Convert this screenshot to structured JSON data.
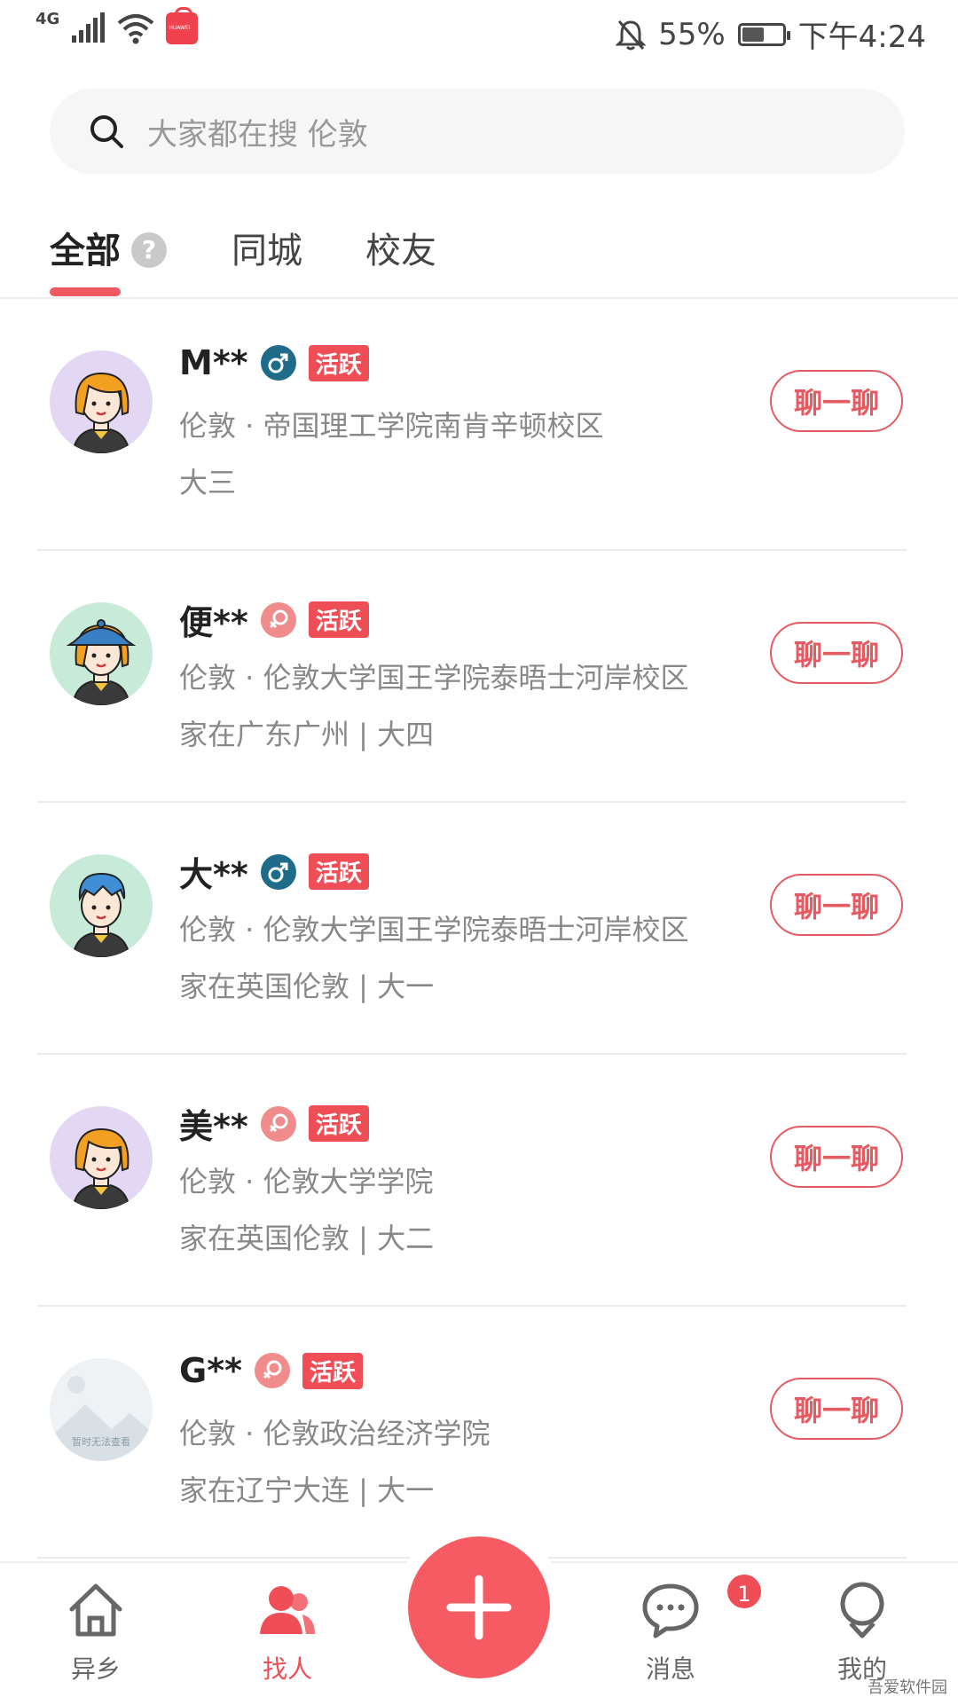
{
  "status_bar": {
    "network": "4G",
    "app_badge": "HUAWEI",
    "battery_percent": "55%",
    "battery_level": 0.55,
    "time": "下午4:24"
  },
  "search": {
    "placeholder": "大家都在搜 伦敦"
  },
  "tabs": [
    {
      "label": "全部",
      "active": true
    },
    {
      "label": "同城",
      "active": false
    },
    {
      "label": "校友",
      "active": false
    }
  ],
  "help_symbol": "?",
  "users": [
    {
      "name": "M**",
      "gender": "male",
      "badge": "活跃",
      "school": "伦敦 · 帝国理工学院南肯辛顿校区",
      "info": "大三",
      "button": "聊一聊",
      "avatar": "girl-orange-hair"
    },
    {
      "name": "便**",
      "gender": "female",
      "badge": "活跃",
      "school": "伦敦 · 伦敦大学国王学院泰晤士河岸校区",
      "info": "家在广东广州 | 大四",
      "button": "聊一聊",
      "avatar": "girl-blue-cap"
    },
    {
      "name": "大**",
      "gender": "male",
      "badge": "活跃",
      "school": "伦敦 · 伦敦大学国王学院泰晤士河岸校区",
      "info": "家在英国伦敦 | 大一",
      "button": "聊一聊",
      "avatar": "boy-blue-hair"
    },
    {
      "name": "美**",
      "gender": "female",
      "badge": "活跃",
      "school": "伦敦 · 伦敦大学学院",
      "info": "家在英国伦敦 | 大二",
      "button": "聊一聊",
      "avatar": "girl-orange-hair"
    },
    {
      "name": "G**",
      "gender": "female",
      "badge": "活跃",
      "school": "伦敦 · 伦敦政治经济学院",
      "info": "家在辽宁大连 | 大一",
      "button": "聊一聊",
      "avatar": "placeholder",
      "avatar_text": "暂时无法查看"
    }
  ],
  "nav": {
    "home": "异乡",
    "find": "找人",
    "messages": "消息",
    "messages_badge": "1",
    "me": "我的"
  },
  "watermark": "吾爱软件园",
  "colors": {
    "accent": "#ef4e57",
    "male": "#1e6b8a",
    "female": "#f08c8c"
  }
}
